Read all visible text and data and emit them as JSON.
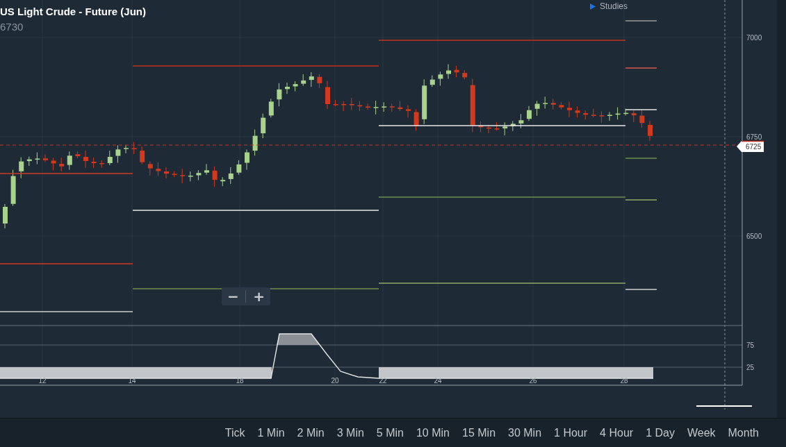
{
  "instrument": {
    "title": "US Light Crude - Future (Jun)",
    "last_price": "6730"
  },
  "studies_toggle": {
    "label": "Studies",
    "expanded": false
  },
  "price_axis": {
    "ticks": [
      "7000",
      "6750",
      "6500"
    ],
    "current_price": "6725"
  },
  "indicator_axis": {
    "ticks": [
      "75",
      "25"
    ]
  },
  "time_axis": {
    "labels": [
      "12",
      "14",
      "18",
      "20",
      "22",
      "24",
      "26",
      "28"
    ]
  },
  "zoom_controls": {
    "zoom_out": "−",
    "zoom_in": "+"
  },
  "timeframes": [
    {
      "label": "Tick"
    },
    {
      "label": "1 Min"
    },
    {
      "label": "2 Min"
    },
    {
      "label": "3 Min"
    },
    {
      "label": "5 Min"
    },
    {
      "label": "10 Min"
    },
    {
      "label": "15 Min"
    },
    {
      "label": "30 Min"
    },
    {
      "label": "1 Hour"
    },
    {
      "label": "4 Hour"
    },
    {
      "label": "1 Day"
    },
    {
      "label": "Week"
    },
    {
      "label": "Month"
    }
  ]
}
